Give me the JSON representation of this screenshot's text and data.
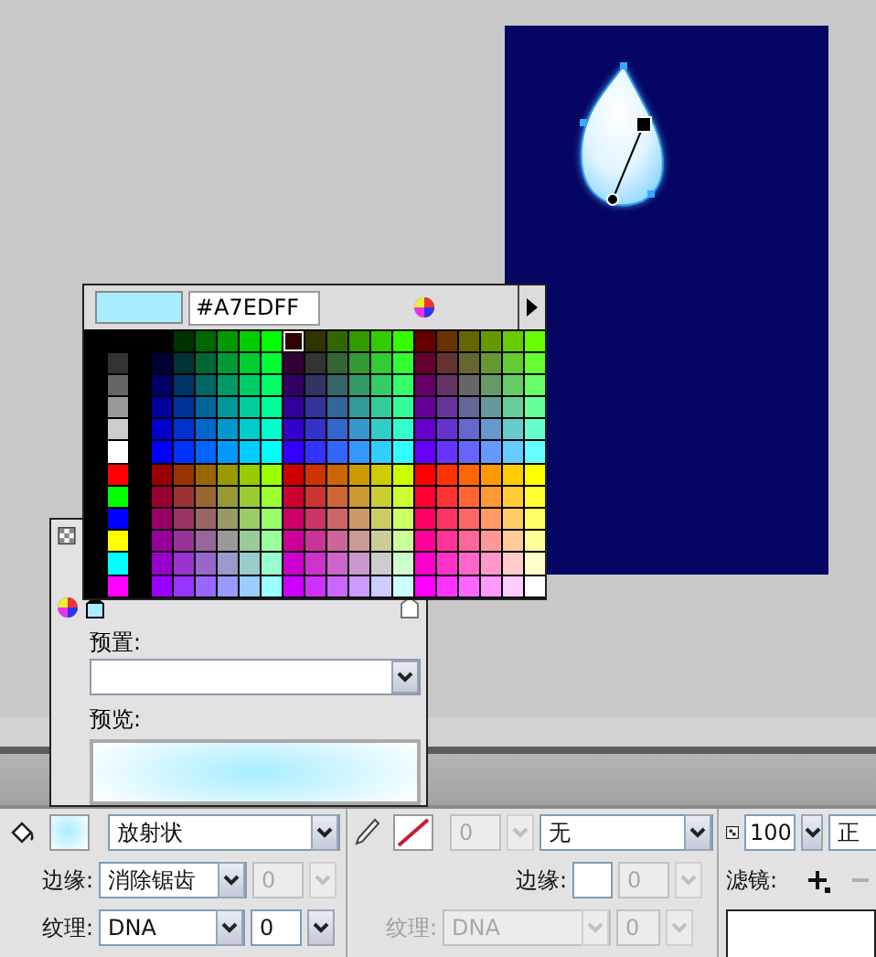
{
  "color_picker": {
    "hex": "#A7EDFF"
  },
  "gradient_editor": {
    "stops": [
      {
        "color": "#A7EDFF",
        "selected": true
      },
      {
        "color": "#FFFFFF",
        "selected": false
      }
    ],
    "preset_label": "预置:",
    "preview_label": "预览:"
  },
  "properties": {
    "fill": {
      "type": "放射状",
      "edge_label": "边缘:",
      "edge": "消除锯齿",
      "edge_value": {
        "value": "0",
        "disabled": true
      },
      "texture_label": "纹理:",
      "texture": {
        "value": "DNA",
        "disabled": false
      },
      "texture_value": {
        "value": "0",
        "disabled": false
      }
    },
    "stroke": {
      "weight": {
        "value": "0",
        "disabled": true
      },
      "style": "无",
      "edge_label": "边缘:",
      "edge_value": {
        "value": "0",
        "disabled": true
      },
      "texture_label": "纹理:",
      "texture": {
        "value": "DNA",
        "disabled": true
      },
      "texture_value": {
        "value": "0",
        "disabled": true
      }
    },
    "display": {
      "alpha": "100",
      "blend": "正",
      "filter_label": "滤镜:"
    }
  }
}
